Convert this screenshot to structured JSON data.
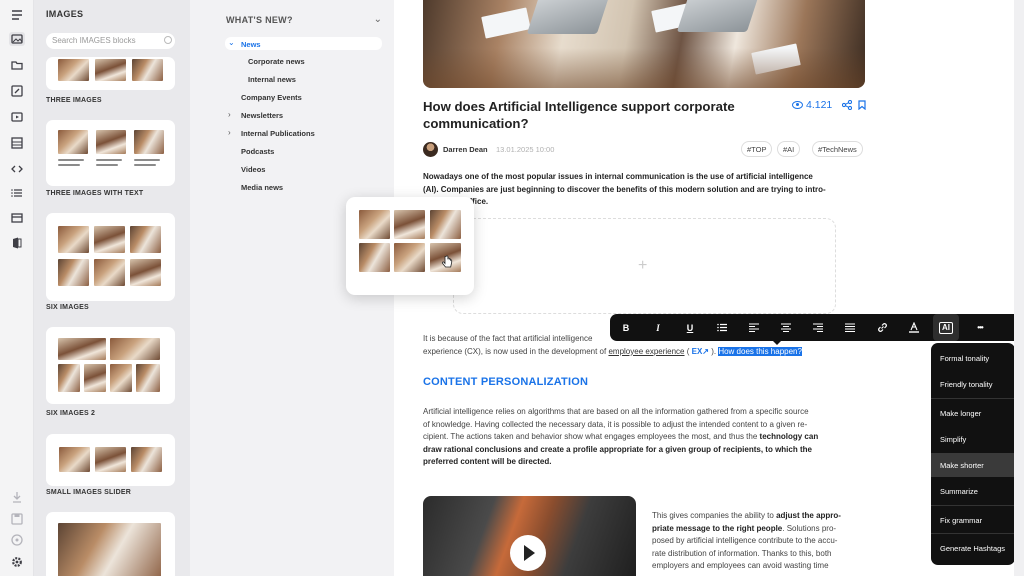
{
  "rail": {
    "icons": [
      "menu-icon",
      "image-icon",
      "folder-icon",
      "edit-icon",
      "video-icon",
      "table-icon",
      "code-icon",
      "list-icon",
      "layout-icon",
      "office-icon",
      "download-icon",
      "save-icon",
      "history-icon",
      "settings-icon"
    ]
  },
  "images_panel": {
    "title": "IMAGES",
    "search_placeholder": "Search IMAGES blocks",
    "blocks": [
      "THREE IMAGES",
      "THREE IMAGES WITH TEXT",
      "SIX IMAGES",
      "SIX IMAGES 2",
      "SMALL IMAGES SLIDER"
    ]
  },
  "nav": {
    "title": "WHAT'S NEW?",
    "items": [
      "News",
      "Corporate news",
      "Internal news",
      "Company Events",
      "Newsletters",
      "Internal Publications",
      "Podcasts",
      "Videos",
      "Media news"
    ]
  },
  "article": {
    "title": "How does Artificial Intelligence support corporate communication?",
    "views": "4.121",
    "author": "Darren Dean",
    "date": "13.01.2025 10:00",
    "tags": [
      "#TOP",
      "#AI",
      "#TechNews"
    ],
    "lead_1": "Nowadays one of the most popular issues in internal communication is the use of artificial intelligence",
    "lead_2": "(AI). Companies are just beginning to discover the benefits of this modern solution and are trying to intro-",
    "lead_3": "ir office.",
    "p1_line1": "It is because of the fact that artificial intelligence",
    "p1_line2_a": "experience (CX), is now used in the development of",
    "p1_link": "employee experience",
    "p1_ex": "EX",
    "p1_highlight": "How does this happen?",
    "heading": "CONTENT PERSONALIZATION",
    "p2_1": "Artificial intelligence relies on algorithms that are based on all the information gathered from a specific source",
    "p2_2": "of knowledge. Having collected the necessary data, it is possible to adjust the intended content to a given re-",
    "p2_3": "cipient. The actions taken and behavior show what engages employees the most, and thus the",
    "p2_3b": "technology can",
    "p2_4": "draw rational conclusions and create a profile appropriate for a given group of recipients, to which the",
    "p2_5": "preferred content will be directed.",
    "p3_1a": "This gives companies the ability to",
    "p3_1b": "adjust the appro-",
    "p3_2a": "priate message to the right people",
    "p3_2b": ". Solutions pro-",
    "p3_3": "posed by artificial intelligence contribute to the accu-",
    "p3_4": "rate distribution of information. Thanks to this, both",
    "p3_5": "employers and employees can avoid wasting time"
  },
  "toolbar": {
    "buttons": [
      "B",
      "I",
      "U",
      "bullet-list-icon",
      "align-left-icon",
      "align-center-icon",
      "align-right-icon",
      "align-justify-icon",
      "link-icon",
      "text-color-icon",
      "AI",
      "more-icon"
    ],
    "ai_label": "AI",
    "b": "B",
    "i": "I",
    "u": "U",
    "more": "•••"
  },
  "ai_menu": {
    "items": [
      "Formal tonality",
      "Friendly tonality",
      "Make longer",
      "Simplify",
      "Make shorter",
      "Summarize",
      "Fix grammar",
      "Generate Hashtags"
    ],
    "hovered": "Make shorter"
  },
  "colors": {
    "accent": "#1a73e8",
    "toolbar_bg": "#111111",
    "panel_bg": "#e9e9ec"
  }
}
